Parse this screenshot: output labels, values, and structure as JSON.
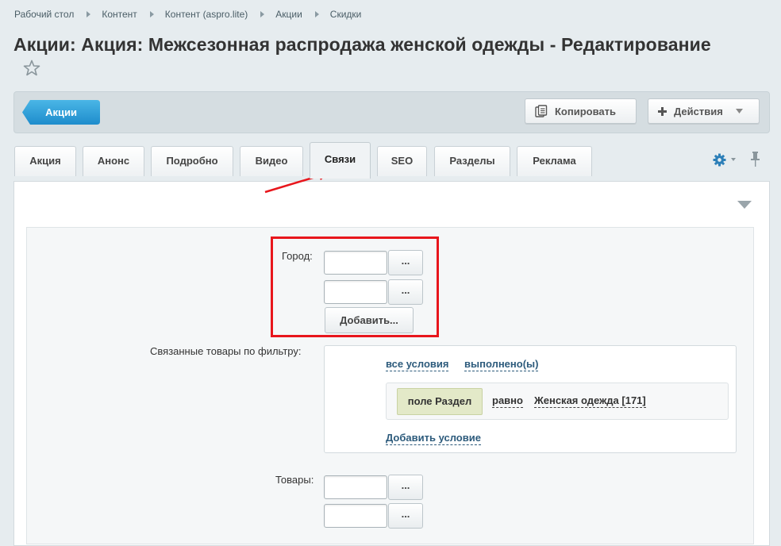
{
  "breadcrumb": {
    "items": [
      "Рабочий стол",
      "Контент",
      "Контент (aspro.lite)",
      "Акции",
      "Скидки"
    ]
  },
  "page": {
    "title": "Акции: Акция: Межсезонная распродажа женской одежды - Редактирование"
  },
  "toolbar": {
    "back_label": "Акции",
    "copy_label": "Копировать",
    "actions_label": "Действия"
  },
  "tabs": [
    {
      "label": "Акция",
      "active": false
    },
    {
      "label": "Анонс",
      "active": false
    },
    {
      "label": "Подробно",
      "active": false
    },
    {
      "label": "Видео",
      "active": false
    },
    {
      "label": "Связи",
      "active": true
    },
    {
      "label": "SEO",
      "active": false
    },
    {
      "label": "Разделы",
      "active": false
    },
    {
      "label": "Реклама",
      "active": false
    }
  ],
  "form": {
    "city": {
      "label": "Город:",
      "inputs": [
        "",
        ""
      ],
      "browse_label": "...",
      "add_label": "Добавить..."
    },
    "filter": {
      "label": "Связанные товары по фильтру:",
      "all_conditions": "все условия",
      "fulfilled": "выполнено(ы)",
      "condition": {
        "field": "поле Раздел",
        "operator": "равно",
        "value": "Женская одежда [171]"
      },
      "add_condition": "Добавить условие"
    },
    "products": {
      "label": "Товары:",
      "inputs": [
        "",
        ""
      ],
      "browse_label": "..."
    }
  },
  "colors": {
    "accent_blue": "#2c9fd8",
    "annotation_red": "#e8161c",
    "link": "#2d5b7c"
  }
}
